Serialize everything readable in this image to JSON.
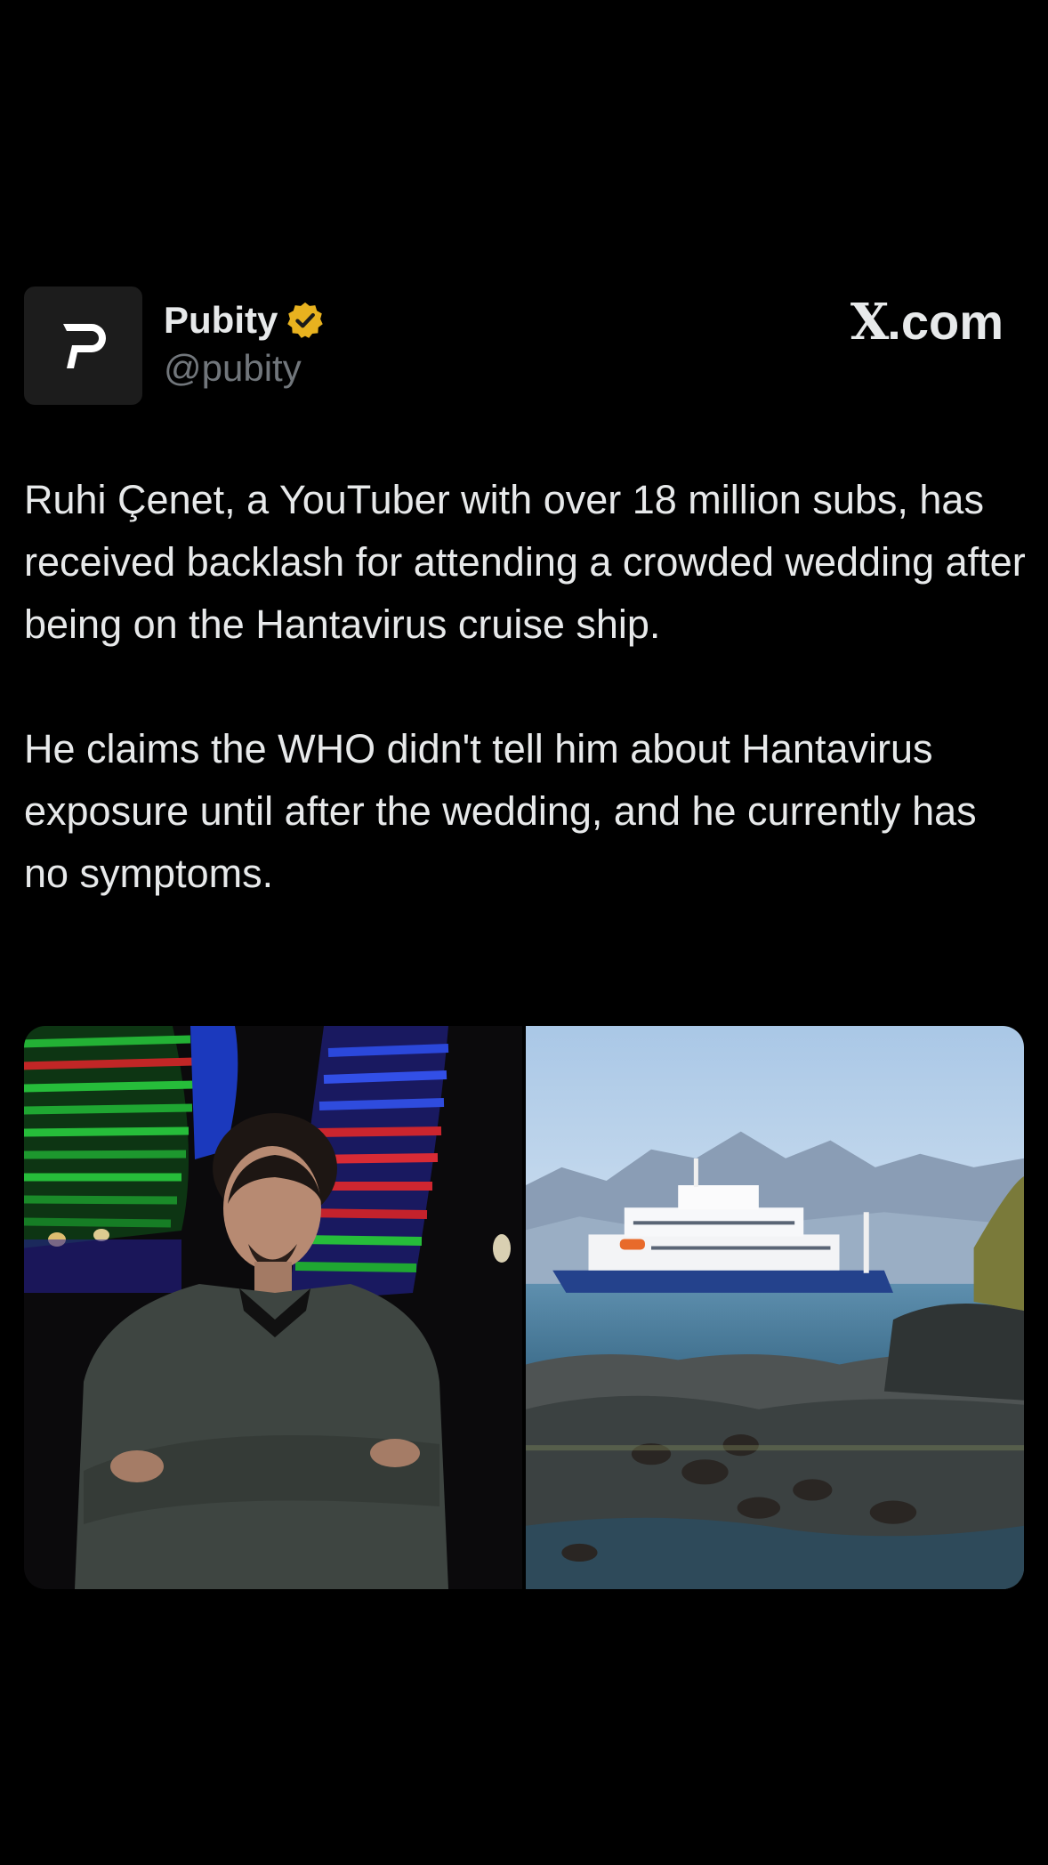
{
  "author": {
    "display_name": "Pubity",
    "handle": "@pubity",
    "verified": true,
    "avatar_icon": "pubity-logo-icon",
    "verified_icon": "gold-verified-badge-icon",
    "verified_color": "#e8b21f"
  },
  "brand": {
    "label": "X.com",
    "x_glyph": "X",
    "suffix": ".com"
  },
  "tweet": {
    "paragraph_1": "Ruhi Çenet, a YouTuber with over 18 million subs, has received backlash for attending a crowded wedding after being on the Hantavirus cruise ship.",
    "paragraph_2": "He claims the WHO didn't tell him about Hantavirus exposure until after the wedding, and he currently has no symptoms."
  },
  "media": [
    {
      "icon": "portrait-photo-icon"
    },
    {
      "icon": "cruise-ship-photo-icon"
    }
  ],
  "colors": {
    "background": "#000000",
    "text": "#e7e9ea",
    "secondary_text": "#71767b",
    "ship_hull": "#24428c"
  }
}
